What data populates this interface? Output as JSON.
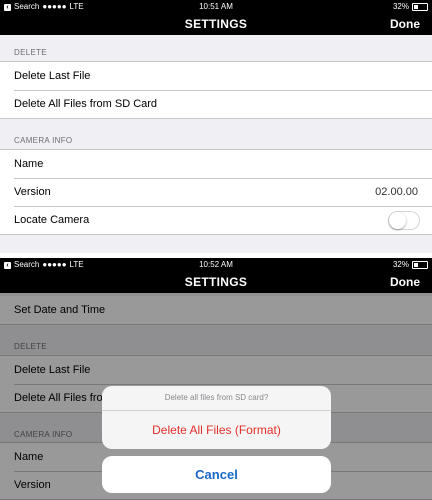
{
  "status_top": {
    "carrier": "Search",
    "signal": "●●●●●",
    "network": "LTE",
    "time": "10:51 AM",
    "battery": "32%",
    "battery_level": 0.32
  },
  "status_bottom": {
    "carrier": "Search",
    "signal": "●●●●●",
    "network": "LTE",
    "time": "10:52 AM",
    "battery": "32%",
    "battery_level": 0.32
  },
  "nav": {
    "title": "SETTINGS",
    "done": "Done"
  },
  "top": {
    "delete_header": "DELETE",
    "delete_last": "Delete Last File",
    "delete_all": "Delete All Files from SD Card",
    "camera_header": "CAMERA INFO",
    "name": "Name",
    "version_label": "Version",
    "version_value": "02.00.00",
    "locate": "Locate Camera",
    "locate_on": false
  },
  "bottom": {
    "set_date": "Set Date and Time",
    "delete_header": "DELETE",
    "delete_last": "Delete Last File",
    "delete_all": "Delete All Files fro",
    "camera_header": "CAMERA INFO",
    "name": "Name",
    "version_label": "Version"
  },
  "dialog": {
    "message": "Delete all files from SD card?",
    "action": "Delete All Files (Format)",
    "cancel": "Cancel"
  },
  "colors": {
    "destructive": "#e0302a",
    "cancel": "#1a68c9",
    "bar": "#000000",
    "background": "#efeff4"
  },
  "icons": {
    "back": "back-to-search-icon",
    "battery": "battery-icon",
    "toggle": "toggle-switch"
  }
}
